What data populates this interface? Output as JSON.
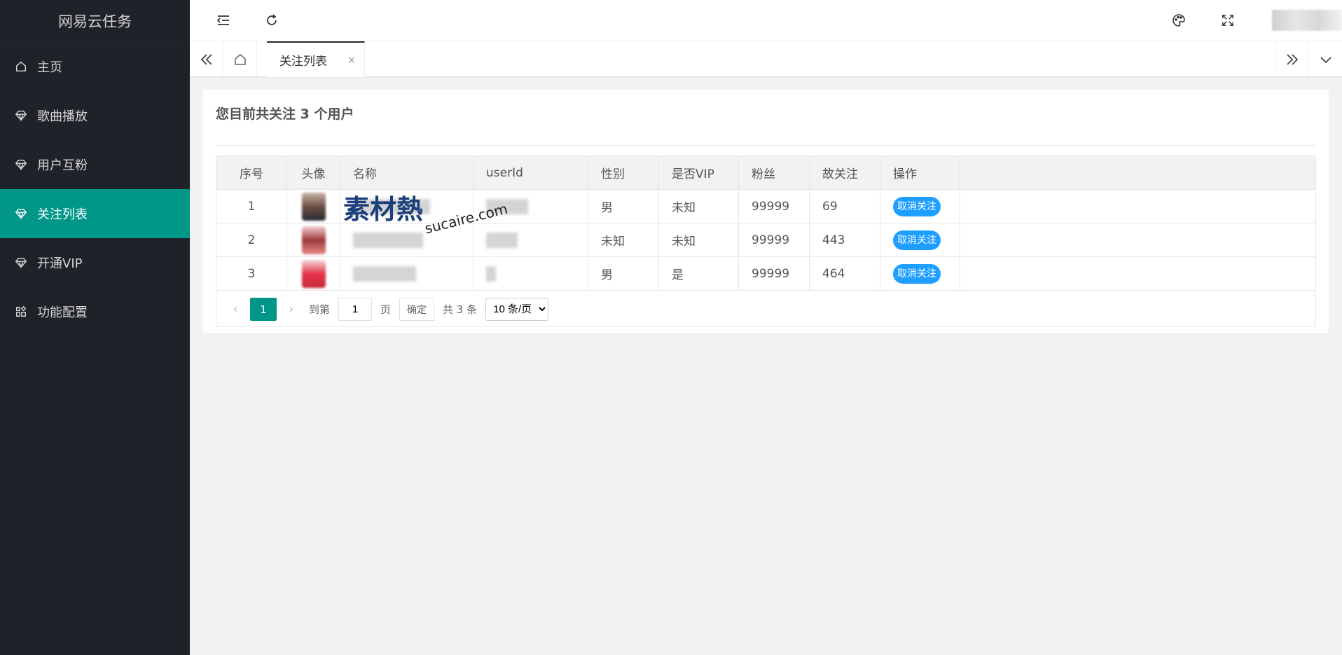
{
  "app": {
    "title": "网易云任务"
  },
  "sidebar": {
    "items": [
      {
        "label": "主页",
        "icon": "home-icon"
      },
      {
        "label": "歌曲播放",
        "icon": "diamond-icon"
      },
      {
        "label": "用户互粉",
        "icon": "diamond-icon"
      },
      {
        "label": "关注列表",
        "icon": "diamond-icon",
        "active": true
      },
      {
        "label": "开通VIP",
        "icon": "diamond-icon"
      },
      {
        "label": "功能配置",
        "icon": "apps-icon"
      }
    ]
  },
  "tabs": {
    "active_label": "关注列表",
    "close": "×"
  },
  "card": {
    "title": "您目前共关注 3 个用户"
  },
  "table": {
    "headers": [
      "序号",
      "头像",
      "名称",
      "userId",
      "性别",
      "是否VIP",
      "粉丝",
      "故关注",
      "操作"
    ],
    "rows": [
      {
        "index": "1",
        "gender": "男",
        "vip": "未知",
        "fans": "99999",
        "following": "69",
        "action": "取消关注"
      },
      {
        "index": "2",
        "gender": "未知",
        "vip": "未知",
        "fans": "99999",
        "following": "443",
        "action": "取消关注"
      },
      {
        "index": "3",
        "gender": "男",
        "vip": "是",
        "fans": "99999",
        "following": "464",
        "action": "取消关注"
      }
    ]
  },
  "pager": {
    "current": "1",
    "goto_label": "到第",
    "page_value": "1",
    "page_unit": "页",
    "confirm": "确定",
    "total": "共 3 条",
    "per_page": "10 条/页"
  },
  "watermark": {
    "text1": "素材熱",
    "text2": "sucaire.com"
  },
  "colors": {
    "sidebar": "#20222a",
    "active": "#009688",
    "button": "#1e9fff"
  }
}
